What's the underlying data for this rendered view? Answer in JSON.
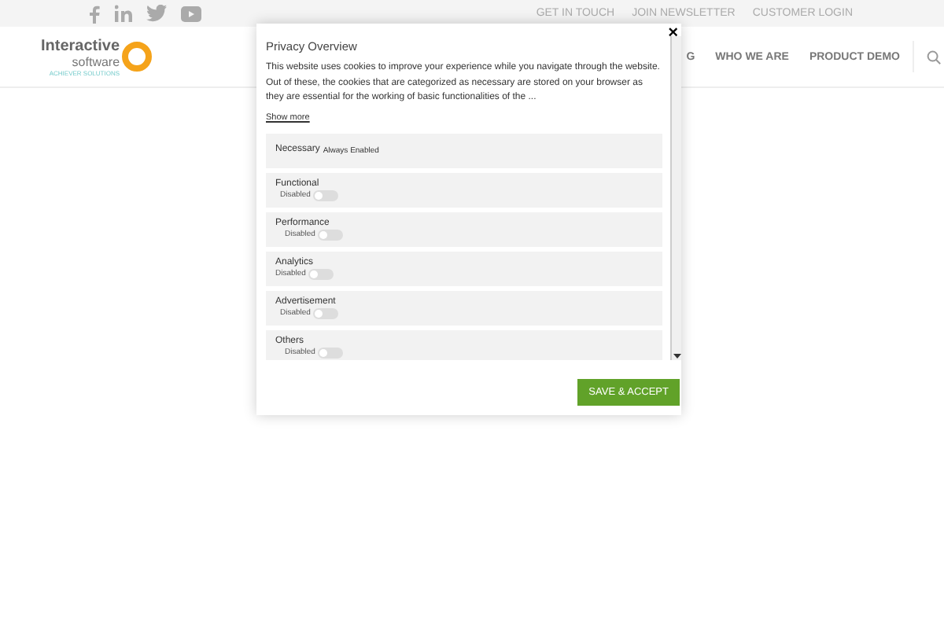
{
  "top_links": [
    "GET IN TOUCH",
    "JOIN NEWSLETTER",
    "CUSTOMER LOGIN"
  ],
  "logo": {
    "name": "Interactive",
    "sub": "software",
    "tagline": "ACHIEVER SOLUTIONS"
  },
  "nav": [
    "G",
    "WHO WE ARE",
    "PRODUCT DEMO"
  ],
  "modal": {
    "title": "Privacy Overview",
    "text": "This website uses cookies to improve your experience while you navigate through the website. Out of these, the cookies that are categorized as necessary are stored on your browser as they are essential for the working of basic functionalities of the ...",
    "show_more": "Show more",
    "close": "×",
    "categories": [
      {
        "kind": "always",
        "name": "Necessary",
        "status": "Always Enabled"
      },
      {
        "kind": "toggle",
        "name": "Functional",
        "status": "Disabled",
        "on": false
      },
      {
        "kind": "toggle",
        "name": "Performance",
        "status": "Disabled",
        "on": false
      },
      {
        "kind": "toggle",
        "name": "Analytics",
        "status": "Disabled",
        "on": false
      },
      {
        "kind": "toggle",
        "name": "Advertisement",
        "status": "Disabled",
        "on": false
      },
      {
        "kind": "toggle",
        "name": "Others",
        "status": "Disabled",
        "on": false
      }
    ],
    "button": "SAVE & ACCEPT"
  }
}
